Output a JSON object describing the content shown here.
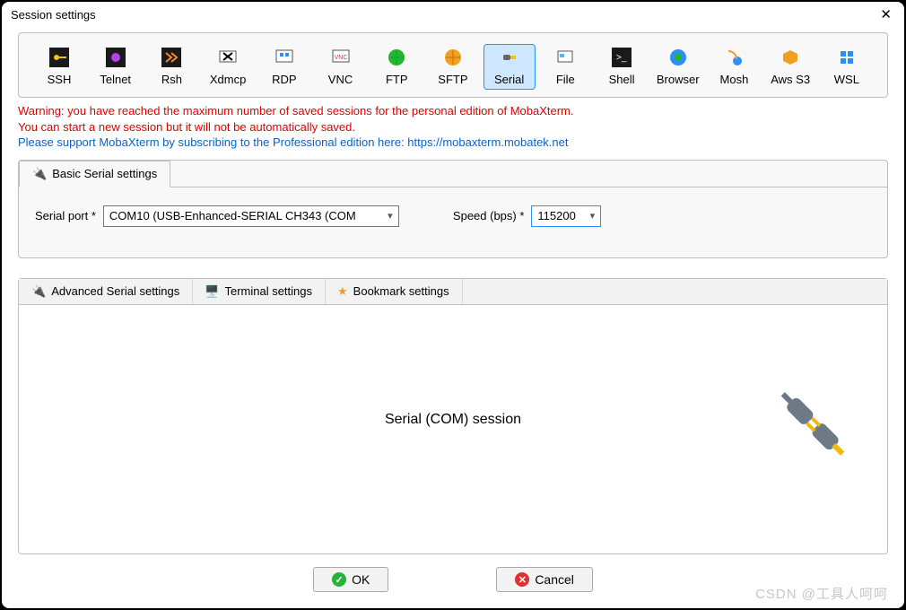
{
  "window": {
    "title": "Session settings"
  },
  "types": {
    "items": [
      {
        "label": "SSH"
      },
      {
        "label": "Telnet"
      },
      {
        "label": "Rsh"
      },
      {
        "label": "Xdmcp"
      },
      {
        "label": "RDP"
      },
      {
        "label": "VNC"
      },
      {
        "label": "FTP"
      },
      {
        "label": "SFTP"
      },
      {
        "label": "Serial"
      },
      {
        "label": "File"
      },
      {
        "label": "Shell"
      },
      {
        "label": "Browser"
      },
      {
        "label": "Mosh"
      },
      {
        "label": "Aws S3"
      },
      {
        "label": "WSL"
      }
    ],
    "selected": "Serial"
  },
  "warning": {
    "line1": "Warning: you have reached the maximum number of saved sessions for the personal edition of MobaXterm.",
    "line2": "You can start a new session but it will not be automatically saved.",
    "line3": "Please support MobaXterm by subscribing to the Professional edition here: https://mobaxterm.mobatek.net"
  },
  "basic": {
    "tab_label": "Basic Serial settings",
    "port_label": "Serial port *",
    "port_value": "COM10  (USB-Enhanced-SERIAL CH343 (COM",
    "speed_label": "Speed (bps) *",
    "speed_value": "115200"
  },
  "adv_tabs": {
    "t1": "Advanced Serial settings",
    "t2": "Terminal settings",
    "t3": "Bookmark settings",
    "body_title": "Serial (COM) session"
  },
  "buttons": {
    "ok": "OK",
    "cancel": "Cancel"
  },
  "watermark": "CSDN @工具人呵呵"
}
